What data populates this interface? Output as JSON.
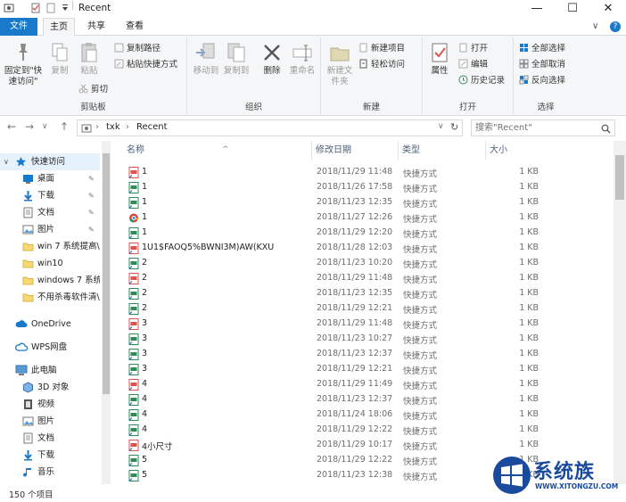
{
  "window": {
    "title": "Recent",
    "minimize_glyph": "—",
    "maximize_glyph": "☐",
    "close_glyph": "✕"
  },
  "tabs": [
    {
      "label": "文件"
    },
    {
      "label": "主页"
    },
    {
      "label": "共享"
    },
    {
      "label": "查看"
    }
  ],
  "tabs_right": {
    "expand_glyph": "∨",
    "help_glyph": "?"
  },
  "ribbon": {
    "groups": {
      "clipboard": "剪贴板",
      "organize": "组织",
      "new": "新建",
      "open": "打开",
      "select": "选择"
    },
    "pin_quick_access": "固定到\"快速访问\"",
    "copy": "复制",
    "paste": "粘贴",
    "copy_path": "复制路径",
    "paste_shortcut": "粘贴快捷方式",
    "cut": "剪切",
    "move_to": "移动到",
    "copy_to": "复制到",
    "delete": "删除",
    "rename": "重命名",
    "new_folder": "新建文件夹",
    "new_item": "新建项目",
    "easy_access": "轻松访问",
    "properties": "属性",
    "open": "打开",
    "edit": "编辑",
    "history": "历史记录",
    "select_all": "全部选择",
    "select_none": "全部取消",
    "invert_selection": "反向选择"
  },
  "address": {
    "crumbs": [
      "txk",
      "Recent"
    ],
    "separator": "›",
    "refresh_glyph": "↻",
    "search_placeholder": "搜索\"Recent\""
  },
  "nav_buttons": {
    "back": "←",
    "forward": "→",
    "dropdown": "∨",
    "up": "↑"
  },
  "navpane": {
    "quick_access": "快速访问",
    "items": [
      {
        "label": "桌面",
        "pinned": true
      },
      {
        "label": "下载",
        "pinned": true
      },
      {
        "label": "文档",
        "pinned": true
      },
      {
        "label": "图片",
        "pinned": true
      },
      {
        "label": "win 7 系统提高\\",
        "pinned": false
      },
      {
        "label": "win10",
        "pinned": false
      },
      {
        "label": "windows 7 系统",
        "pinned": false
      },
      {
        "label": "不用杀毒软件清\\",
        "pinned": false
      }
    ],
    "onedrive": "OneDrive",
    "wps": "WPS网盘",
    "this_pc": "此电脑",
    "pc_items": [
      {
        "label": "3D 对象"
      },
      {
        "label": "视频"
      },
      {
        "label": "图片"
      },
      {
        "label": "文档"
      },
      {
        "label": "下载"
      },
      {
        "label": "音乐"
      }
    ],
    "pin_glyph": "📌"
  },
  "columns": {
    "name": "名称",
    "date": "修改日期",
    "type": "类型",
    "size": "大小",
    "sort_glyph": "^"
  },
  "files": [
    {
      "name": "1",
      "date": "2018/11/29 11:48",
      "type": "快捷方式",
      "size": "1 KB",
      "icon": "pdf"
    },
    {
      "name": "1",
      "date": "2018/11/26 17:58",
      "type": "快捷方式",
      "size": "1 KB",
      "icon": "doc"
    },
    {
      "name": "1",
      "date": "2018/11/23 12:35",
      "type": "快捷方式",
      "size": "1 KB",
      "icon": "doc"
    },
    {
      "name": "1",
      "date": "2018/11/27 12:26",
      "type": "快捷方式",
      "size": "1 KB",
      "icon": "chrome"
    },
    {
      "name": "1",
      "date": "2018/11/29 12:20",
      "type": "快捷方式",
      "size": "1 KB",
      "icon": "doc"
    },
    {
      "name": "1U1$FAOQ5%BWNI3M)AW(KXU",
      "date": "2018/11/28 12:03",
      "type": "快捷方式",
      "size": "1 KB",
      "icon": "pdf"
    },
    {
      "name": "2",
      "date": "2018/11/23 10:20",
      "type": "快捷方式",
      "size": "1 KB",
      "icon": "doc"
    },
    {
      "name": "2",
      "date": "2018/11/29 11:48",
      "type": "快捷方式",
      "size": "1 KB",
      "icon": "pdf"
    },
    {
      "name": "2",
      "date": "2018/11/23 12:35",
      "type": "快捷方式",
      "size": "1 KB",
      "icon": "doc"
    },
    {
      "name": "2",
      "date": "2018/11/29 12:21",
      "type": "快捷方式",
      "size": "1 KB",
      "icon": "doc"
    },
    {
      "name": "3",
      "date": "2018/11/29 11:48",
      "type": "快捷方式",
      "size": "1 KB",
      "icon": "pdf"
    },
    {
      "name": "3",
      "date": "2018/11/23 10:27",
      "type": "快捷方式",
      "size": "1 KB",
      "icon": "doc"
    },
    {
      "name": "3",
      "date": "2018/11/23 12:37",
      "type": "快捷方式",
      "size": "1 KB",
      "icon": "doc"
    },
    {
      "name": "3",
      "date": "2018/11/29 12:21",
      "type": "快捷方式",
      "size": "1 KB",
      "icon": "doc"
    },
    {
      "name": "4",
      "date": "2018/11/29 11:49",
      "type": "快捷方式",
      "size": "1 KB",
      "icon": "pdf"
    },
    {
      "name": "4",
      "date": "2018/11/23 12:37",
      "type": "快捷方式",
      "size": "1 KB",
      "icon": "doc"
    },
    {
      "name": "4",
      "date": "2018/11/24 18:06",
      "type": "快捷方式",
      "size": "1 KB",
      "icon": "doc"
    },
    {
      "name": "4",
      "date": "2018/11/29 12:22",
      "type": "快捷方式",
      "size": "1 KB",
      "icon": "doc"
    },
    {
      "name": "4小尺寸",
      "date": "2018/11/29 10:17",
      "type": "快捷方式",
      "size": "1 KB",
      "icon": "pdf"
    },
    {
      "name": "5",
      "date": "2018/11/29 12:22",
      "type": "快捷方式",
      "size": "1 KB",
      "icon": "doc"
    },
    {
      "name": "5",
      "date": "2018/11/23 12:38",
      "type": "快捷方式",
      "size": "1 KB",
      "icon": "doc"
    }
  ],
  "status": {
    "count": "150 个项目"
  },
  "watermark": {
    "text": "系统族",
    "url": "WWW.XITONGZU.COM"
  },
  "colors": {
    "accent": "#1979ca",
    "pdf_icon": "#d9534f",
    "doc_icon": "#2e8b57",
    "header_text": "#4c607a"
  }
}
